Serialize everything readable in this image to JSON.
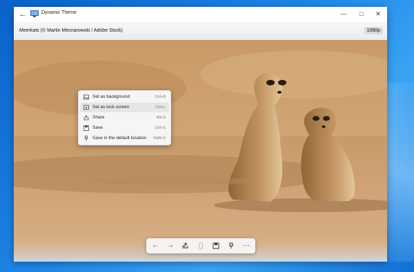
{
  "window": {
    "title": "Dynamic Theme",
    "controls": {
      "minimize": "—",
      "maximize": "□",
      "close": "✕"
    }
  },
  "header": {
    "photo_title": "Meerkats (© Martin Mecnarowski / Adobe Stock)",
    "resolution_badge": "1080p"
  },
  "context_menu": {
    "items": [
      {
        "label": "Set as background",
        "shortcut": "Ctrl+B",
        "icon": "image-icon"
      },
      {
        "label": "Set as lock screen",
        "shortcut": "Ctrl+L",
        "icon": "lock-screen-icon",
        "highlighted": true
      },
      {
        "label": "Share",
        "shortcut": "Alt+S",
        "icon": "share-icon"
      },
      {
        "label": "Save",
        "shortcut": "Ctrl+S",
        "icon": "save-icon"
      },
      {
        "label": "Save in the default location",
        "shortcut": "Shift+S",
        "icon": "pin-icon"
      }
    ]
  },
  "toolbar": {
    "buttons": [
      "back-arrow-icon",
      "forward-arrow-icon",
      "share-icon",
      "phone-icon",
      "save-icon",
      "pin-icon",
      "more-icon"
    ],
    "more_label": "···"
  },
  "colors": {
    "desktop": "#1f86e8",
    "window_bg": "#f3f3f3",
    "menu_highlight": "#e6e6e6"
  }
}
